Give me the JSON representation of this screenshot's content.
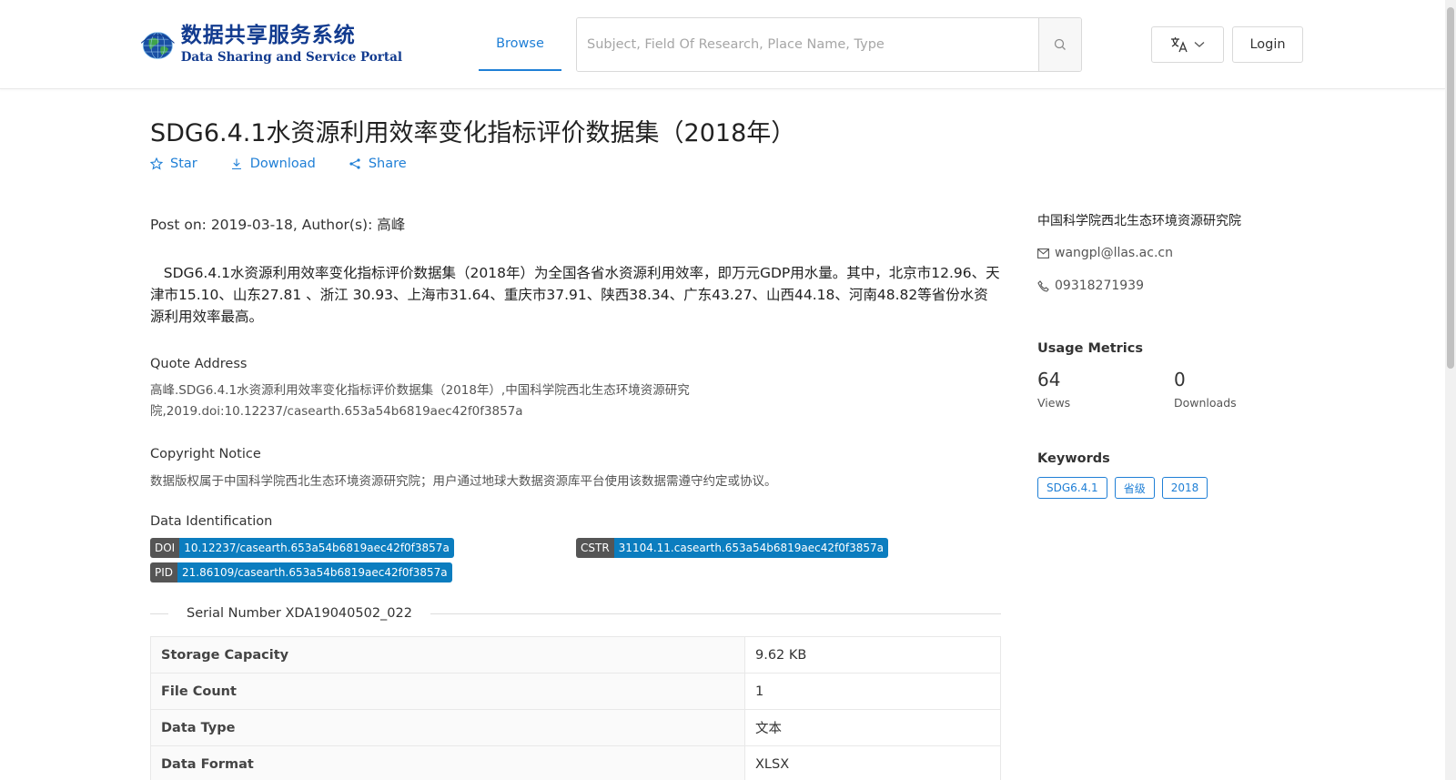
{
  "header": {
    "logo_cn": "数据共享服务系统",
    "logo_en": "Data Sharing and Service Portal",
    "nav_browse": "Browse",
    "search_placeholder": "Subject, Field Of Research, Place Name, Type",
    "login_label": "Login"
  },
  "dataset": {
    "title": "SDG6.4.1水资源利用效率变化指标评价数据集（2018年）",
    "actions": {
      "star": "Star",
      "download": "Download",
      "share": "Share"
    },
    "post_on": "Post on: 2019-03-18, Author(s): 高峰",
    "description": "SDG6.4.1水资源利用效率变化指标评价数据集（2018年）为全国各省水资源利用效率，即万元GDP用水量。其中，北京市12.96、天津市15.10、山东27.81 、浙江 30.93、上海市31.64、重庆市37.91、陕西38.34、广东43.27、山西44.18、河南48.82等省份水资源利用效率最高。",
    "quote_title": "Quote Address",
    "quote_text": "高峰.SDG6.4.1水资源利用效率变化指标评价数据集（2018年）,中国科学院西北生态环境资源研究院,2019.doi:10.12237/casearth.653a54b6819aec42f0f3857a",
    "copyright_title": "Copyright Notice",
    "copyright_text": "数据版权属于中国科学院西北生态环境资源研究院；用户通过地球大数据资源库平台使用该数据需遵守约定或协议。",
    "identification_title": "Data Identification",
    "ids": {
      "doi_key": "DOI",
      "doi_val": "10.12237/casearth.653a54b6819aec42f0f3857a",
      "cstr_key": "CSTR",
      "cstr_val": "31104.11.casearth.653a54b6819aec42f0f3857a",
      "pid_key": "PID",
      "pid_val": "21.86109/casearth.653a54b6819aec42f0f3857a"
    },
    "serial": "Serial Number XDA19040502_022",
    "meta_rows": [
      {
        "key": "Storage Capacity",
        "value": "9.62 KB"
      },
      {
        "key": "File Count",
        "value": "1"
      },
      {
        "key": "Data Type",
        "value": "文本"
      },
      {
        "key": "Data Format",
        "value": "XLSX"
      }
    ]
  },
  "sidebar": {
    "organization": "中国科学院西北生态环境资源研究院",
    "email": "wangpl@llas.ac.cn",
    "phone": "09318271939",
    "usage_title": "Usage Metrics",
    "views_num": "64",
    "views_label": "Views",
    "downloads_num": "0",
    "downloads_label": "Downloads",
    "keywords_title": "Keywords",
    "keywords": [
      "SDG6.4.1",
      "省级",
      "2018"
    ]
  },
  "colors": {
    "accent": "#1f7fd6",
    "id_value_bg": "#0b7dbf",
    "id_key_bg": "#555555",
    "logo_blue": "#123b8f"
  }
}
